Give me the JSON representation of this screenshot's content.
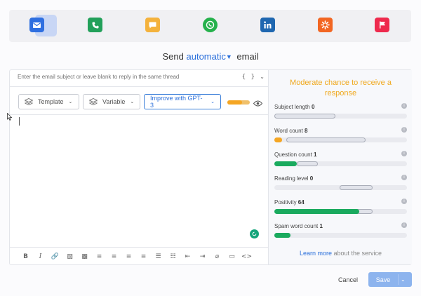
{
  "channels": [
    {
      "icon": "email-icon",
      "color": "#2f6fe0"
    },
    {
      "icon": "phone-icon",
      "color": "#22a05a"
    },
    {
      "icon": "sms-icon",
      "color": "#f4b23c"
    },
    {
      "icon": "whatsapp-icon",
      "color": "#25b14b"
    },
    {
      "icon": "linkedin-icon",
      "color": "#1f67b0"
    },
    {
      "icon": "integration-icon",
      "color": "#f26622"
    },
    {
      "icon": "flag-icon",
      "color": "#ee2a4d"
    }
  ],
  "header": {
    "prefix": "Send",
    "mode": "automatic",
    "suffix": "email"
  },
  "editor": {
    "subject_placeholder": "Enter the email subject or leave blank to reply in the same thread",
    "braces": "{ }",
    "template_label": "Template",
    "variable_label": "Variable",
    "gpt_label": "Improve with GPT-3",
    "toggle_level": 0.65
  },
  "format_toolbar": [
    {
      "name": "bold-icon",
      "glyph": "B"
    },
    {
      "name": "italic-icon",
      "glyph": "I"
    },
    {
      "name": "link-icon",
      "glyph": "🔗"
    },
    {
      "name": "image-icon",
      "glyph": "▨"
    },
    {
      "name": "image-filled-icon",
      "glyph": "▩"
    },
    {
      "name": "align-left-icon",
      "glyph": "≡"
    },
    {
      "name": "align-center-icon",
      "glyph": "≡"
    },
    {
      "name": "align-right-icon",
      "glyph": "≡"
    },
    {
      "name": "align-justify-icon",
      "glyph": "≡"
    },
    {
      "name": "bullet-list-icon",
      "glyph": "☰"
    },
    {
      "name": "numbered-list-icon",
      "glyph": "☷"
    },
    {
      "name": "outdent-icon",
      "glyph": "⇤"
    },
    {
      "name": "indent-icon",
      "glyph": "⇥"
    },
    {
      "name": "attachment-icon",
      "glyph": "⌀"
    },
    {
      "name": "video-icon",
      "glyph": "▭"
    },
    {
      "name": "code-icon",
      "glyph": "<>"
    }
  ],
  "panel": {
    "title": "Moderate chance to receive a response",
    "metrics": [
      {
        "label": "Subject length",
        "value": "0",
        "fill": 0.0,
        "fill_color": "#f5a623",
        "ideal": [
          0.0,
          0.46
        ]
      },
      {
        "label": "Word count",
        "value": "8",
        "fill": 0.06,
        "fill_color": "#f5a623",
        "ideal": [
          0.09,
          0.69
        ]
      },
      {
        "label": "Question count",
        "value": "1",
        "fill": 0.17,
        "fill_color": "#1aaa5e",
        "ideal": [
          0.17,
          0.33
        ]
      },
      {
        "label": "Reading level",
        "value": "0",
        "fill": 0.0,
        "fill_color": "#1aaa5e",
        "ideal": [
          0.49,
          0.74
        ]
      },
      {
        "label": "Positivity",
        "value": "64",
        "fill": 0.64,
        "fill_color": "#1aaa5e",
        "ideal": [
          0.55,
          0.74
        ]
      },
      {
        "label": "Spam word count",
        "value": "1",
        "fill": 0.12,
        "fill_color": "#1aaa5e",
        "ideal": [
          0.0,
          0.12
        ]
      }
    ],
    "learn_link": "Learn more",
    "learn_suffix": "about the service"
  },
  "footer": {
    "cancel_label": "Cancel",
    "save_label": "Save"
  }
}
